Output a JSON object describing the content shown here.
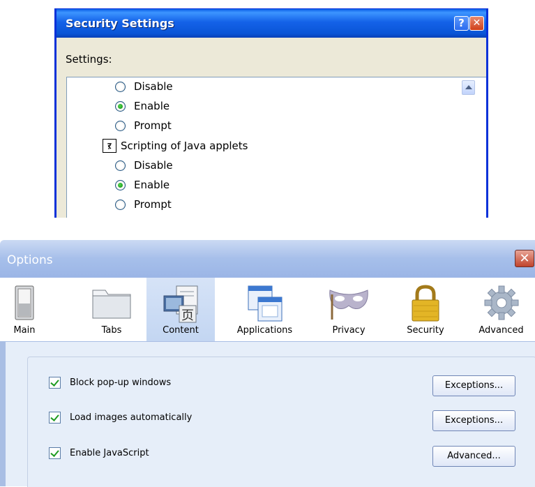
{
  "security_dialog": {
    "title": "Security Settings",
    "help_glyph": "?",
    "close_glyph": "✕",
    "settings_label": "Settings:",
    "items": [
      {
        "kind": "radio",
        "label": "Disable",
        "checked": false
      },
      {
        "kind": "radio",
        "label": "Enable",
        "checked": true
      },
      {
        "kind": "radio",
        "label": "Prompt",
        "checked": false
      },
      {
        "kind": "header",
        "label": "Scripting of Java applets",
        "icon": "script-icon"
      },
      {
        "kind": "radio",
        "label": "Disable",
        "checked": false
      },
      {
        "kind": "radio",
        "label": "Enable",
        "checked": true
      },
      {
        "kind": "radio",
        "label": "Prompt",
        "checked": false
      }
    ]
  },
  "options_dialog": {
    "title": "Options",
    "close_glyph": "✕",
    "tabs": [
      {
        "label": "Main",
        "icon": "switch-icon",
        "selected": false
      },
      {
        "label": "Tabs",
        "icon": "folder-tabs-icon",
        "selected": false
      },
      {
        "label": "Content",
        "icon": "content-icon",
        "selected": true
      },
      {
        "label": "Applications",
        "icon": "applications-icon",
        "selected": false
      },
      {
        "label": "Privacy",
        "icon": "mask-icon",
        "selected": false
      },
      {
        "label": "Security",
        "icon": "padlock-icon",
        "selected": false
      },
      {
        "label": "Advanced",
        "icon": "gear-icon",
        "selected": false
      }
    ],
    "options": [
      {
        "label": "Block pop-up windows",
        "checked": true,
        "button": "Exceptions..."
      },
      {
        "label": "Load images automatically",
        "checked": true,
        "button": "Exceptions..."
      },
      {
        "label": "Enable JavaScript",
        "checked": true,
        "button": "Advanced..."
      }
    ]
  },
  "colors": {
    "xp_blue": "#0831d9",
    "panel_bg": "#e6eef9",
    "tab_selected": "#c3d6f2"
  }
}
